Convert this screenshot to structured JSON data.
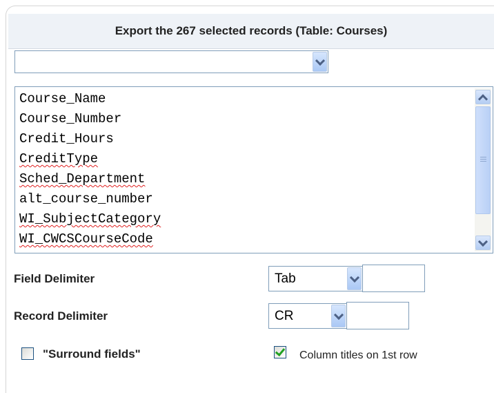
{
  "header": {
    "title": "Export the 267 selected records (Table: Courses)"
  },
  "template_select": {
    "value": ""
  },
  "fields": {
    "items": [
      "Course_Name",
      "Course_Number",
      "Credit_Hours",
      "CreditType",
      "Sched_Department",
      "alt_course_number",
      "WI_SubjectCategory",
      "WI_CWCSCourseCode"
    ]
  },
  "field_delimiter": {
    "label": "Field Delimiter",
    "selected": "Tab",
    "custom_value": ""
  },
  "record_delimiter": {
    "label": "Record Delimiter",
    "selected": "CR",
    "custom_value": ""
  },
  "options": {
    "surround_fields": {
      "label": "\"Surround fields\"",
      "checked": false
    },
    "column_titles": {
      "label": "Column titles on 1st row",
      "checked": true
    }
  },
  "colors": {
    "accent_check": "#21a121",
    "header_bg": "#eef2f7",
    "border": "#7f9db9"
  },
  "icons": [
    "chevron-down-icon",
    "chevron-up-icon",
    "checkmark-icon"
  ]
}
